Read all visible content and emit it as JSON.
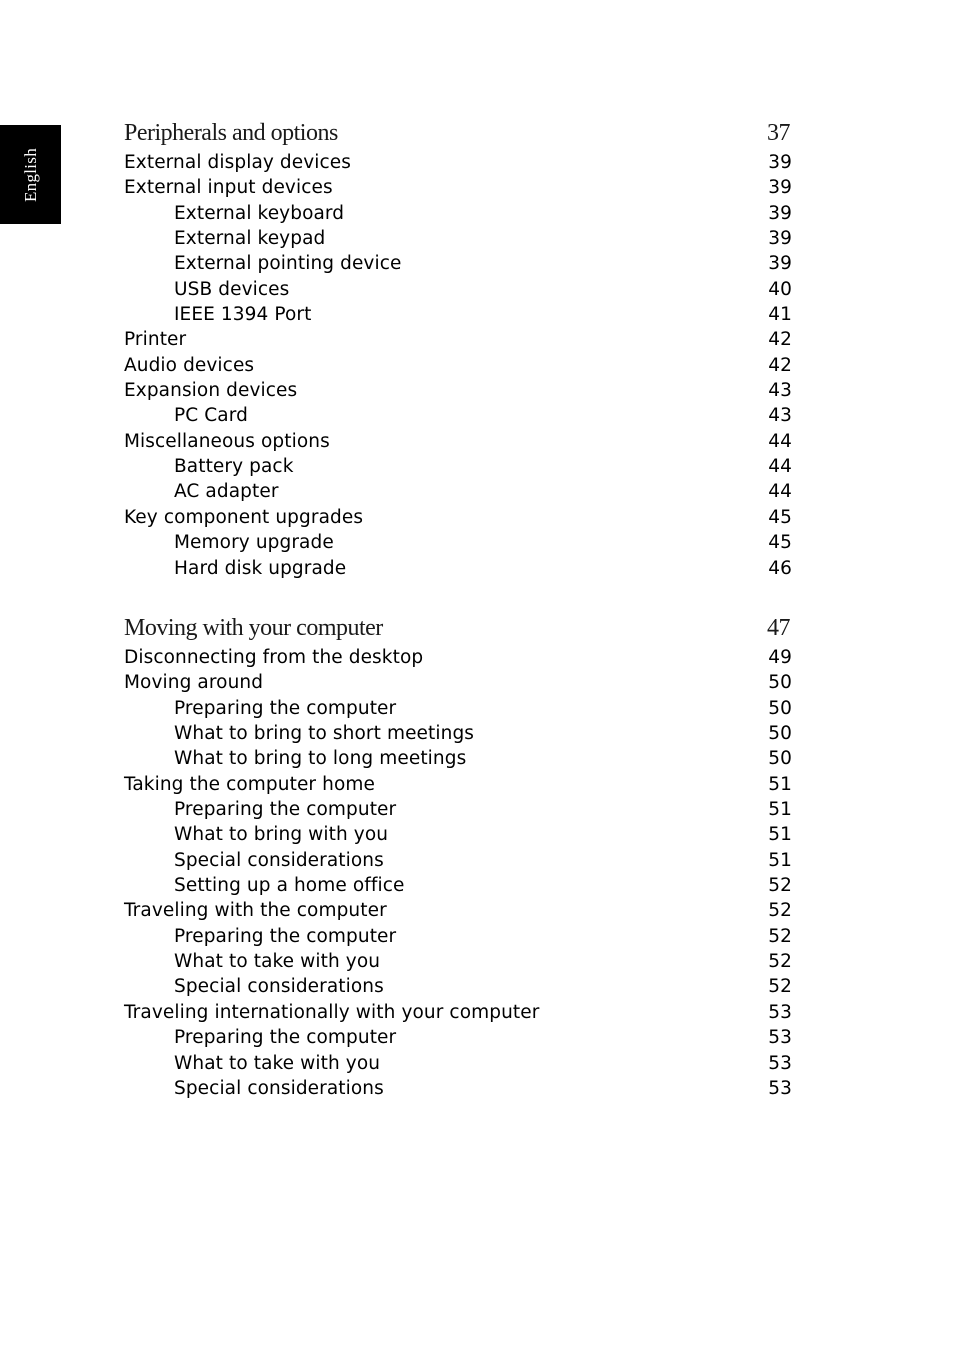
{
  "side_tab": {
    "label": "English"
  },
  "sections": [
    {
      "title": "Peripherals and options",
      "page": "37",
      "entries": [
        {
          "title": "External display devices",
          "page": "39",
          "level": 1
        },
        {
          "title": "External input devices",
          "page": "39",
          "level": 1
        },
        {
          "title": "External keyboard",
          "page": "39",
          "level": 2
        },
        {
          "title": "External keypad",
          "page": "39",
          "level": 2
        },
        {
          "title": "External pointing device",
          "page": "39",
          "level": 2
        },
        {
          "title": "USB devices",
          "page": "40",
          "level": 2
        },
        {
          "title": "IEEE 1394 Port",
          "page": "41",
          "level": 2
        },
        {
          "title": "Printer",
          "page": "42",
          "level": 1
        },
        {
          "title": "Audio devices",
          "page": "42",
          "level": 1
        },
        {
          "title": "Expansion devices",
          "page": "43",
          "level": 1
        },
        {
          "title": "PC Card",
          "page": "43",
          "level": 2
        },
        {
          "title": "Miscellaneous options",
          "page": "44",
          "level": 1
        },
        {
          "title": "Battery pack",
          "page": "44",
          "level": 2
        },
        {
          "title": "AC adapter",
          "page": "44",
          "level": 2
        },
        {
          "title": "Key component upgrades",
          "page": "45",
          "level": 1
        },
        {
          "title": "Memory upgrade",
          "page": "45",
          "level": 2
        },
        {
          "title": "Hard disk upgrade",
          "page": "46",
          "level": 2
        }
      ]
    },
    {
      "title": "Moving with your computer",
      "page": "47",
      "entries": [
        {
          "title": "Disconnecting from the desktop",
          "page": "49",
          "level": 1
        },
        {
          "title": "Moving around",
          "page": "50",
          "level": 1
        },
        {
          "title": "Preparing the computer",
          "page": "50",
          "level": 2
        },
        {
          "title": "What to bring to short meetings",
          "page": "50",
          "level": 2
        },
        {
          "title": "What to bring to long meetings",
          "page": "50",
          "level": 2
        },
        {
          "title": "Taking the computer home",
          "page": "51",
          "level": 1
        },
        {
          "title": "Preparing the computer",
          "page": "51",
          "level": 2
        },
        {
          "title": "What to bring with you",
          "page": "51",
          "level": 2
        },
        {
          "title": "Special considerations",
          "page": "51",
          "level": 2
        },
        {
          "title": "Setting up a home office",
          "page": "52",
          "level": 2
        },
        {
          "title": "Traveling with the computer",
          "page": "52",
          "level": 1
        },
        {
          "title": "Preparing the computer",
          "page": "52",
          "level": 2
        },
        {
          "title": "What to take with you",
          "page": "52",
          "level": 2
        },
        {
          "title": "Special considerations",
          "page": "52",
          "level": 2
        },
        {
          "title": "Traveling internationally with your computer",
          "page": "53",
          "level": 1
        },
        {
          "title": "Preparing the computer",
          "page": "53",
          "level": 2
        },
        {
          "title": "What to take with you",
          "page": "53",
          "level": 2
        },
        {
          "title": "Special considerations",
          "page": "53",
          "level": 2
        }
      ]
    }
  ]
}
